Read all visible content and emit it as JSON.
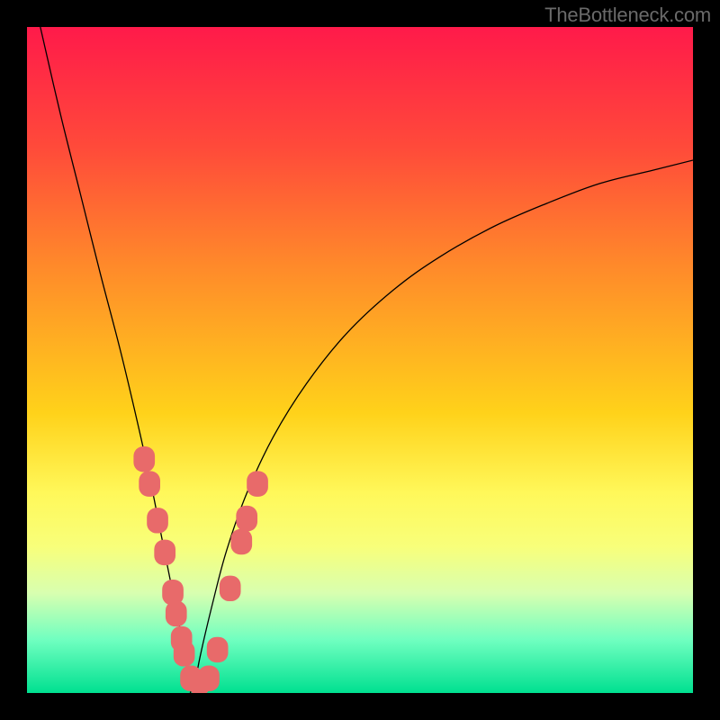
{
  "watermark": "TheBottleneck.com",
  "chart_data": {
    "type": "line",
    "title": "",
    "xlabel": "",
    "ylabel": "",
    "xlim": [
      0,
      100
    ],
    "ylim": [
      0,
      100
    ],
    "gradient_stops": [
      {
        "pos": 0,
        "color": "#ff1a4a"
      },
      {
        "pos": 18,
        "color": "#ff4a3a"
      },
      {
        "pos": 36,
        "color": "#ff8a2a"
      },
      {
        "pos": 58,
        "color": "#ffd21a"
      },
      {
        "pos": 70,
        "color": "#fff85a"
      },
      {
        "pos": 78,
        "color": "#f8ff7a"
      },
      {
        "pos": 85,
        "color": "#d8ffb0"
      },
      {
        "pos": 92,
        "color": "#70ffc0"
      },
      {
        "pos": 100,
        "color": "#00e090"
      }
    ],
    "series": [
      {
        "name": "left-branch",
        "x": [
          2,
          5,
          8,
          11,
          14,
          16.5,
          18.5,
          20,
          21.3,
          22.5,
          23.5,
          24.3,
          25
        ],
        "y": [
          100,
          87,
          75,
          63,
          51.5,
          41,
          32,
          24.5,
          18,
          12,
          7,
          3.3,
          0
        ]
      },
      {
        "name": "right-branch",
        "x": [
          25,
          26,
          28,
          30,
          33,
          37,
          42,
          48,
          55,
          62,
          70,
          78,
          86,
          94,
          100
        ],
        "y": [
          0,
          5.5,
          14,
          21.5,
          30,
          38.5,
          46.5,
          54,
          60.5,
          65.5,
          70,
          73.5,
          76.5,
          78.5,
          80
        ]
      }
    ],
    "markers": [
      {
        "x": 17.6,
        "y": 35.1,
        "r": 1.6
      },
      {
        "x": 18.4,
        "y": 31.4,
        "r": 1.6
      },
      {
        "x": 19.6,
        "y": 25.9,
        "r": 1.6
      },
      {
        "x": 20.7,
        "y": 21.1,
        "r": 1.6
      },
      {
        "x": 21.9,
        "y": 15.1,
        "r": 1.6
      },
      {
        "x": 22.4,
        "y": 11.9,
        "r": 1.6
      },
      {
        "x": 23.2,
        "y": 8.1,
        "r": 1.6
      },
      {
        "x": 23.6,
        "y": 5.9,
        "r": 1.6
      },
      {
        "x": 24.6,
        "y": 2.2,
        "r": 1.6
      },
      {
        "x": 25.9,
        "y": 1.6,
        "r": 1.6
      },
      {
        "x": 27.3,
        "y": 2.2,
        "r": 1.6
      },
      {
        "x": 28.6,
        "y": 6.5,
        "r": 1.6
      },
      {
        "x": 30.5,
        "y": 15.7,
        "r": 1.6
      },
      {
        "x": 32.2,
        "y": 22.7,
        "r": 1.6
      },
      {
        "x": 33.0,
        "y": 26.2,
        "r": 1.6
      },
      {
        "x": 34.6,
        "y": 31.4,
        "r": 1.6
      }
    ],
    "marker_color": "#e86a6a",
    "curve_color": "#000000",
    "notch_x": 25
  }
}
